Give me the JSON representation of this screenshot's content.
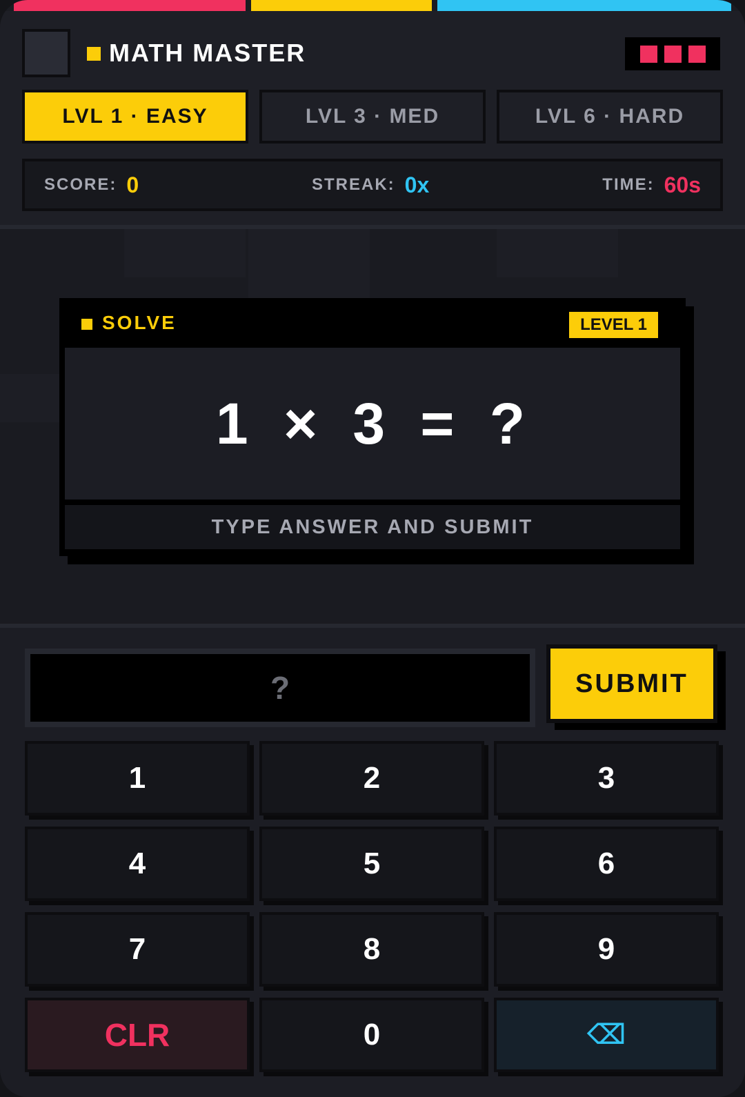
{
  "app": {
    "title": "MATH MASTER",
    "lives": 3
  },
  "colors": {
    "accent": "#fccd09",
    "red": "#f0315f",
    "blue": "#30c4f3"
  },
  "tabs": [
    {
      "label": "LVL 1 · EASY",
      "active": true
    },
    {
      "label": "LVL 3 · MED",
      "active": false
    },
    {
      "label": "LVL 6 · HARD",
      "active": false
    }
  ],
  "stats": {
    "score_label": "SCORE:",
    "score": "0",
    "streak_label": "STREAK:",
    "streak": "0x",
    "time_label": "TIME:",
    "time": "60s"
  },
  "card": {
    "heading": "SOLVE",
    "level_badge": "LEVEL 1",
    "equation": "1 × 3 = ?",
    "hint": "TYPE ANSWER AND SUBMIT"
  },
  "answer": {
    "placeholder": "?"
  },
  "submit_label": "SUBMIT",
  "keys": [
    "1",
    "2",
    "3",
    "4",
    "5",
    "6",
    "7",
    "8",
    "9",
    "CLR",
    "0",
    "⌫"
  ]
}
